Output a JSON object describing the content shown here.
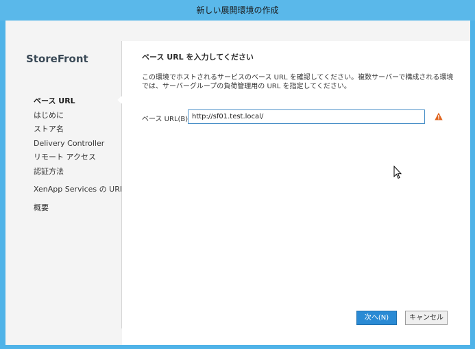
{
  "window": {
    "title": "新しい展開環境の作成"
  },
  "sidebar": {
    "product": "StoreFront",
    "items": [
      {
        "label": "ベース URL",
        "active": true
      },
      {
        "label": "はじめに"
      },
      {
        "label": "ストア名"
      },
      {
        "label": "Delivery Controller"
      },
      {
        "label": "リモート アクセス"
      },
      {
        "label": "認証方法"
      },
      {
        "label": "XenApp Services の URL"
      },
      {
        "label": "概要"
      }
    ]
  },
  "main": {
    "heading": "ベース URL を入力してください",
    "description": "この環境でホストされるサービスのベース URL を確認してください。複数サーバーで構成される環境では、サーバーグループの負荷管理用の URL を指定してください。",
    "base_url_label": "ベース URL(B):",
    "base_url_value": "http://sf01.test.local/"
  },
  "buttons": {
    "next": "次へ(N)",
    "cancel": "キャンセル"
  },
  "colors": {
    "title_bar": "#5ab8ea",
    "primary_button": "#2a8ad4",
    "warning": "#e0641e"
  },
  "icons": {
    "warning": "warning-icon",
    "cursor": "mouse-cursor-icon"
  }
}
